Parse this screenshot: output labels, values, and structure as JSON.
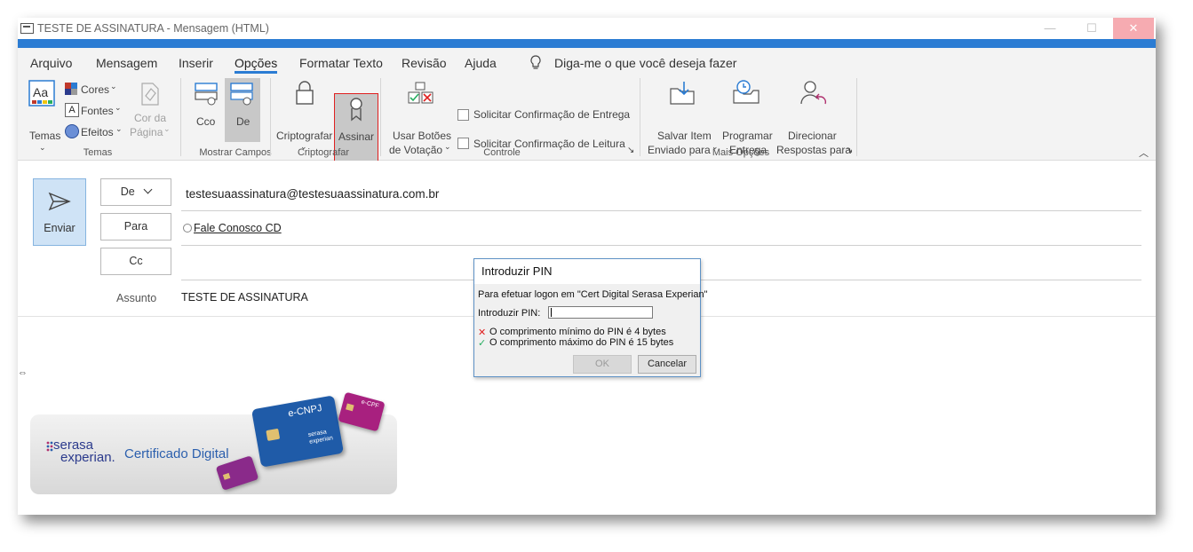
{
  "window": {
    "title": "TESTE DE ASSINATURA  -  Mensagem (HTML)",
    "close_glyph": "✕",
    "min_glyph": "—",
    "max_glyph": "☐"
  },
  "menu": {
    "items": [
      "Arquivo",
      "Mensagem",
      "Inserir",
      "Opções",
      "Formatar Texto",
      "Revisão",
      "Ajuda"
    ],
    "active": "Opções",
    "tell_me": "Diga-me o que você deseja fazer"
  },
  "ribbon": {
    "temas": {
      "temas_label": "Temas",
      "cores_label": "Cores",
      "fontes_label": "Fontes",
      "efeitos_label": "Efeitos",
      "cor_da_label": "Cor da",
      "pagina_label": "Página",
      "group_label": "Temas"
    },
    "mostrar_campos": {
      "cco_label": "Cco",
      "de_label": "De",
      "group_label": "Mostrar Campos"
    },
    "criptografar": {
      "criptografar_label": "Criptografar",
      "assinar_label": "Assinar",
      "group_label": "Criptografar"
    },
    "controle": {
      "usar_botoes_line1": "Usar Botões",
      "usar_botoes_line2": "de Votação",
      "solicitar_entrega": "Solicitar Confirmação de Entrega",
      "solicitar_leitura": "Solicitar Confirmação de Leitura",
      "group_label": "Controle"
    },
    "mais_opcoes": {
      "salvar_line1": "Salvar Item",
      "salvar_line2": "Enviado para",
      "programar_line1": "Programar",
      "programar_line2": "Entrega",
      "direcionar_line1": "Direcionar",
      "direcionar_line2": "Respostas para",
      "group_label": "Mais Opções"
    }
  },
  "compose": {
    "send_label": "Enviar",
    "from_button": "De",
    "to_button": "Para",
    "cc_button": "Cc",
    "from_value": "testesuaassinatura@testesuaassinatura.com.br",
    "to_value": "Fale Conosco CD",
    "subject_label": "Assunto",
    "subject_value": "TESTE DE ASSINATURA"
  },
  "banner": {
    "brand_line1": "serasa",
    "brand_line2": "experian.",
    "product": "Certificado Digital",
    "card_main": "e-CNPJ",
    "card_small": "e-CPF",
    "card_main_brand_line1": "serasa",
    "card_main_brand_line2": "experian"
  },
  "pin_dialog": {
    "title": "Introduzir PIN",
    "message": "Para efetuar logon em \"Cert Digital Serasa Experian\"",
    "pin_label": "Introduzir PIN:",
    "rule_min": "O comprimento mínimo do PIN é 4 bytes",
    "rule_max": "O comprimento máximo do PIN é 15 bytes",
    "ok_label": "OK",
    "cancel_label": "Cancelar"
  },
  "colors": {
    "accent": "#2b7cd3",
    "assinar_highlight": "#e02020",
    "card_blue": "#1f5ba8",
    "card_purple": "#a8207f"
  }
}
